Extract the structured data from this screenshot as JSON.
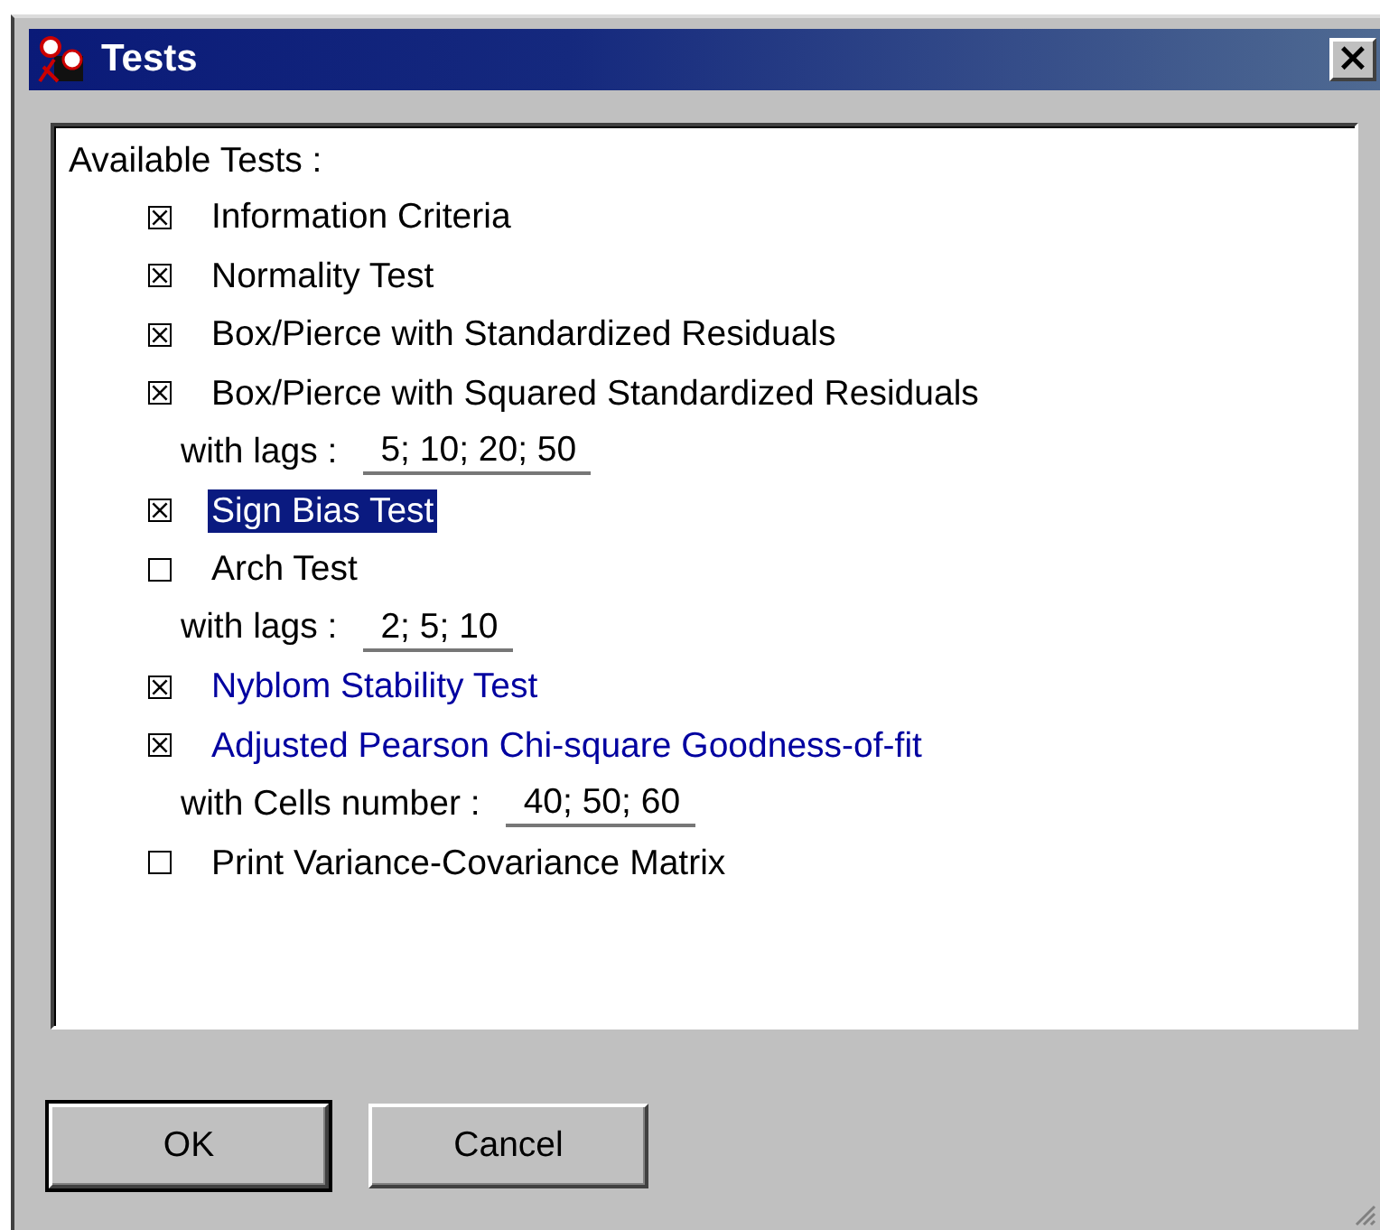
{
  "window": {
    "title": "Tests",
    "close": "×"
  },
  "list": {
    "heading": "Available Tests :",
    "items": [
      {
        "kind": "check",
        "label": "Information Criteria",
        "checked": true,
        "selected": false,
        "color": "#000000"
      },
      {
        "kind": "check",
        "label": "Normality Test",
        "checked": true,
        "selected": false,
        "color": "#000000"
      },
      {
        "kind": "check",
        "label": "Box/Pierce with Standardized Residuals",
        "checked": true,
        "selected": false,
        "color": "#000000"
      },
      {
        "kind": "check",
        "label": "Box/Pierce with Squared Standardized Residuals",
        "checked": true,
        "selected": false,
        "color": "#000000"
      },
      {
        "kind": "lags",
        "label": "with lags :",
        "value": "5; 10; 20; 50"
      },
      {
        "kind": "check",
        "label": "Sign Bias Test",
        "checked": true,
        "selected": true
      },
      {
        "kind": "check",
        "label": "Arch Test",
        "checked": false,
        "selected": false,
        "color": "#000000"
      },
      {
        "kind": "lags",
        "label": "with lags :",
        "value": "2; 5; 10"
      },
      {
        "kind": "check",
        "label": "Nyblom Stability Test",
        "checked": true,
        "selected": false,
        "color": "#0000a0"
      },
      {
        "kind": "check",
        "label": "Adjusted Pearson Chi-square Goodness-of-fit",
        "checked": true,
        "selected": false,
        "color": "#0000a0"
      },
      {
        "kind": "lags",
        "label": "with Cells number :",
        "value": "40; 50; 60"
      },
      {
        "kind": "check",
        "label": "Print Variance-Covariance Matrix",
        "checked": false,
        "selected": false,
        "color": "#000000"
      }
    ]
  },
  "buttons": [
    {
      "label": "OK",
      "default": true
    },
    {
      "label": "Cancel",
      "default": false
    }
  ]
}
